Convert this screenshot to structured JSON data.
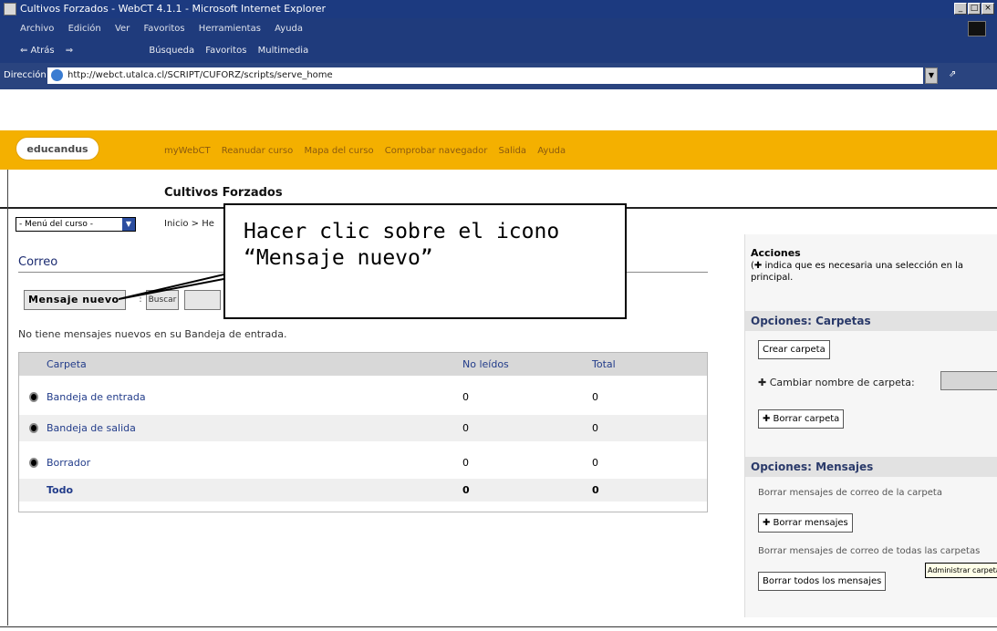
{
  "window": {
    "title": "Cultivos Forzados - WebCT 4.1.1 - Microsoft Internet Explorer",
    "controls": [
      "_",
      "□",
      "×"
    ]
  },
  "menubar": [
    "Archivo",
    "Edición",
    "Ver",
    "Favoritos",
    "Herramientas",
    "Ayuda"
  ],
  "toolbar": [
    "⇐ Atrás",
    "⇒",
    "Búsqueda",
    "Favoritos",
    "Multimedia"
  ],
  "address": {
    "label": "Dirección",
    "url": "http://webct.utalca.cl/SCRIPT/CUFORZ/scripts/serve_home",
    "go": "⇗"
  },
  "header": {
    "logo": "educandus",
    "nav": [
      "myWebCT",
      "Reanudar curso",
      "Mapa del curso",
      "Comprobar navegador",
      "Salida",
      "Ayuda"
    ],
    "course_title": "Cultivos Forzados"
  },
  "course_menu": {
    "label": "- Menú del curso -",
    "arrow": "▼"
  },
  "breadcrumb": "Inicio > He",
  "callout": {
    "line1": "Hacer clic sobre el icono",
    "line2": "“Mensaje nuevo”"
  },
  "mail": {
    "title": "Correo",
    "new_message": "Mensaje nuevo",
    "buscar": "Buscar",
    "no_messages": "No tiene mensajes nuevos en su Bandeja de entrada.",
    "columns": [
      "Carpeta",
      "No leídos",
      "Total"
    ],
    "rows": [
      {
        "folder": "Bandeja de entrada",
        "unread": "0",
        "total": "0"
      },
      {
        "folder": "Bandeja de salida",
        "unread": "0",
        "total": "0"
      },
      {
        "folder": "Borrador",
        "unread": "0",
        "total": "0"
      }
    ],
    "total_row": {
      "folder": "Todo",
      "unread": "0",
      "total": "0"
    }
  },
  "actions": {
    "title": "Acciones",
    "note": "(✚ indica que es necesaria una selección en la principal.",
    "folders_header": "Opciones: Carpetas",
    "create_folder": "Crear carpeta",
    "rename_folder": "✚ Cambiar nombre de carpeta:",
    "delete_folder": "✚ Borrar carpeta",
    "messages_header": "Opciones: Mensajes",
    "delete_text1": "Borrar mensajes de correo de la carpeta",
    "delete_messages": "✚ Borrar mensajes",
    "delete_text2": "Borrar mensajes de correo de todas las carpetas",
    "delete_all": "Borrar todos los mensajes",
    "tooltip": "Administrar carpetas"
  }
}
